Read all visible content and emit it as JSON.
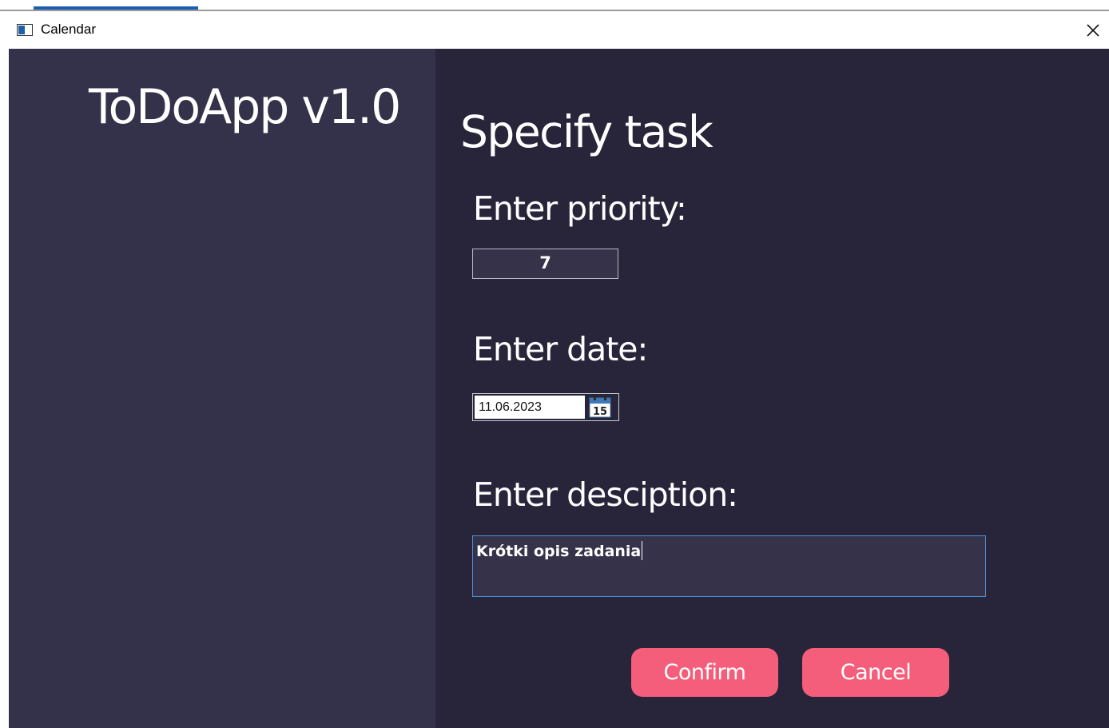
{
  "window": {
    "title": "Calendar",
    "close_glyph": "✕"
  },
  "sidebar": {
    "app_title": "ToDoApp v1.0"
  },
  "form": {
    "heading": "Specify task",
    "priority": {
      "label": "Enter priority:",
      "value": "7"
    },
    "date": {
      "label": "Enter date:",
      "value": "11.06.2023",
      "calendar_icon_day": "15"
    },
    "description": {
      "label": "Enter desciption:",
      "value": "Krótki opis zadania"
    },
    "buttons": {
      "confirm_label": "Confirm",
      "cancel_label": "Cancel"
    }
  },
  "colors": {
    "sidebar_bg": "#34314a",
    "main_bg": "#28253a",
    "input_bg": "#35324a",
    "accent_button": "#f45e7a",
    "focus_border": "#4a90d9",
    "text": "#ffffff"
  },
  "icons": {
    "app": "window-app-icon",
    "close": "close-icon",
    "calendar": "calendar-icon"
  }
}
